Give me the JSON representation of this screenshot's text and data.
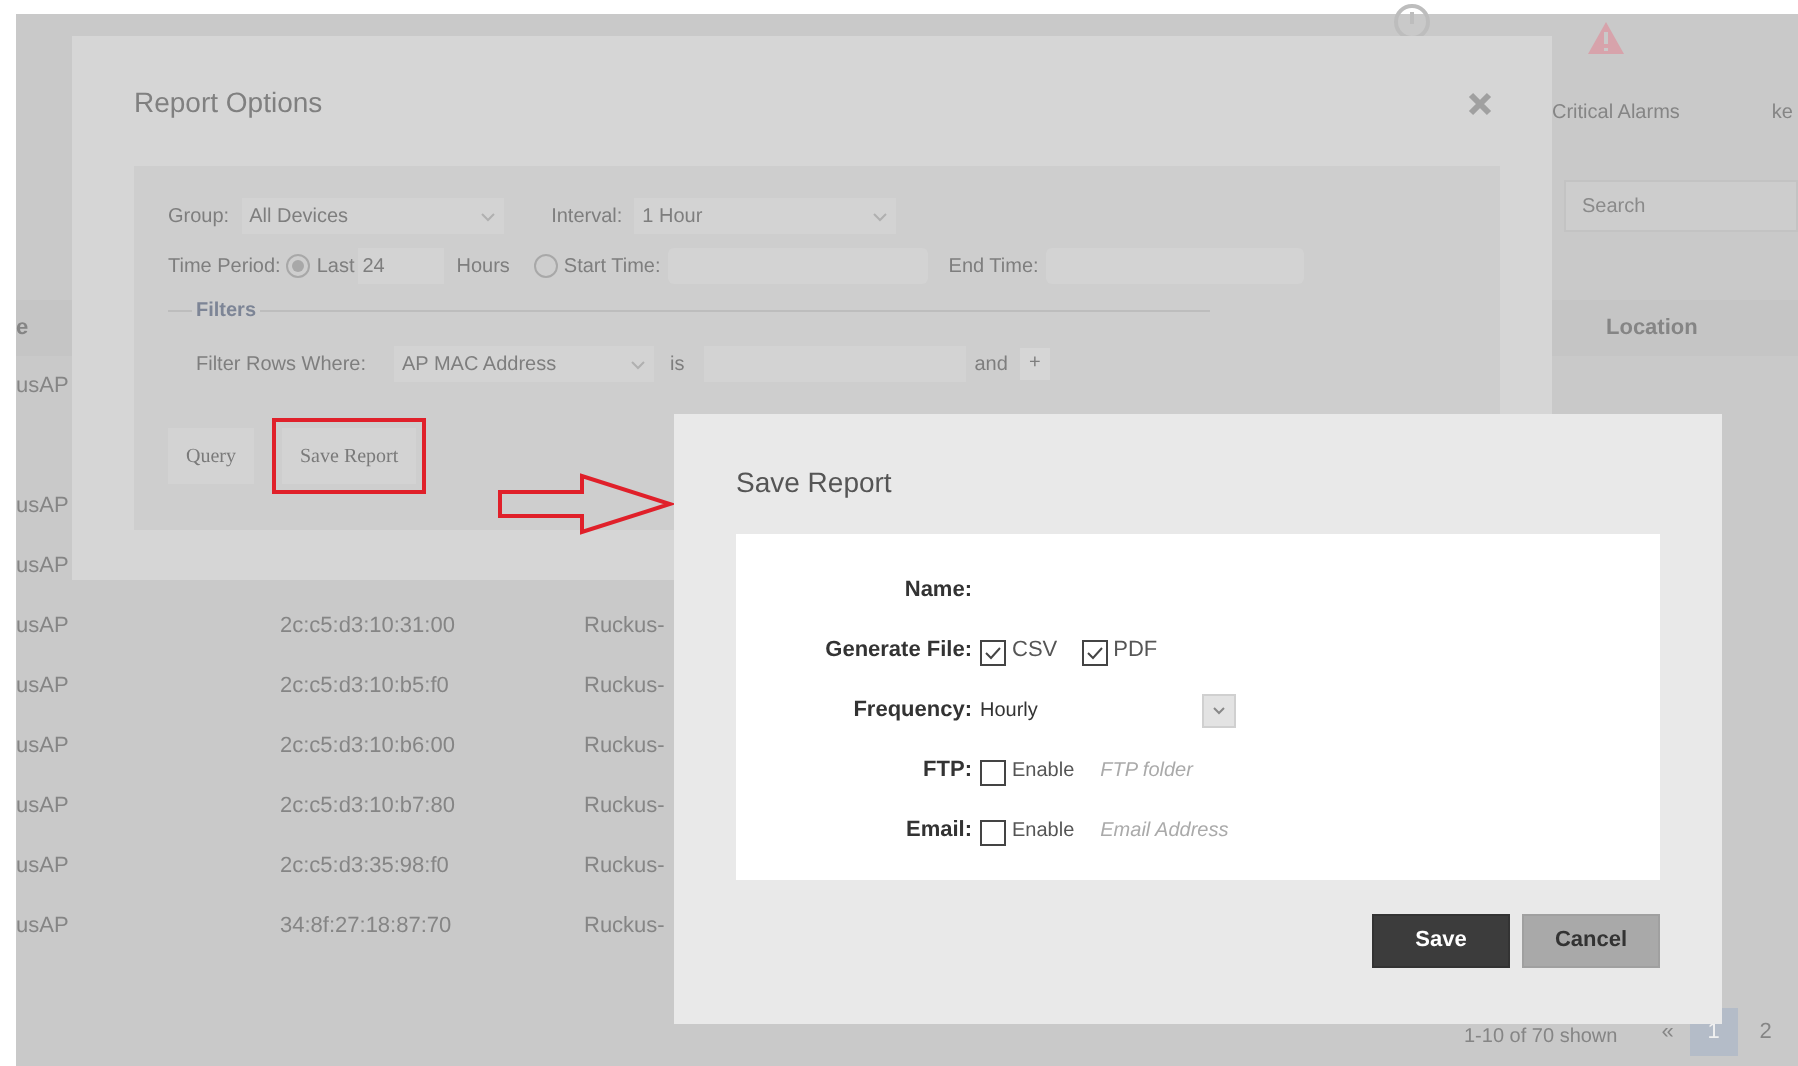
{
  "header": {
    "alarm_label": "Critical Alarms",
    "user": "ke"
  },
  "search": {
    "placeholder": "Search"
  },
  "table": {
    "columns": [
      "e",
      "Location"
    ],
    "rows": [
      {
        "column_1": "usAP"
      },
      {
        "column_1": "usAP"
      },
      {
        "column_1": "usAP"
      },
      {
        "column_1": "usAP",
        "column_2": "2c:c5:d3:10:31:00",
        "column_3": "Ruckus-"
      },
      {
        "column_1": "usAP",
        "column_2": "2c:c5:d3:10:b5:f0",
        "column_3": "Ruckus-"
      },
      {
        "column_1": "usAP",
        "column_2": "2c:c5:d3:10:b6:00",
        "column_3": "Ruckus-"
      },
      {
        "column_1": "usAP",
        "column_2": "2c:c5:d3:10:b7:80",
        "column_3": "Ruckus-"
      },
      {
        "column_1": "usAP",
        "column_2": "2c:c5:d3:35:98:f0",
        "column_3": "Ruckus-"
      },
      {
        "column_1": "usAP",
        "column_2": "34:8f:27:18:87:70",
        "column_3": "Ruckus-"
      }
    ]
  },
  "pagination": {
    "summary": "1-10 of 70 shown",
    "prev": "«",
    "pages": [
      {
        "label": "1",
        "selected": true
      },
      {
        "label": "2",
        "selected": false
      }
    ]
  },
  "report_options": {
    "title": "Report Options",
    "group": {
      "label": "Group:",
      "value": "All Devices"
    },
    "interval": {
      "label": "Interval:",
      "value": "1 Hour"
    },
    "time_period": {
      "label": "Time Period:",
      "options": [
        {
          "label": "Last",
          "selected": true,
          "value": "24",
          "unit": "Hours"
        },
        {
          "label": "Start Time:",
          "selected": false
        }
      ],
      "end_label": "End Time:"
    },
    "filters": {
      "legend": "Filters",
      "label": "Filter Rows Where:",
      "field": "AP MAC Address",
      "operator": "is",
      "conjunction": "and",
      "add": "+"
    },
    "buttons": [
      {
        "label": "Query",
        "highlighted": false
      },
      {
        "label": "Save Report",
        "highlighted": true
      }
    ]
  },
  "save_report": {
    "title": "Save Report",
    "rows": [
      {
        "kind": "name",
        "label": "Name:"
      },
      {
        "kind": "files",
        "label": "Generate File:",
        "options": [
          {
            "label": "CSV",
            "checked": true
          },
          {
            "label": "PDF",
            "checked": true
          }
        ]
      },
      {
        "kind": "select",
        "label": "Frequency:",
        "value": "Hourly"
      },
      {
        "kind": "toggle",
        "label": "FTP:",
        "option": {
          "label": "Enable",
          "checked": false
        },
        "placeholder": "FTP folder"
      },
      {
        "kind": "toggle",
        "label": "Email:",
        "option": {
          "label": "Enable",
          "checked": false
        },
        "placeholder": "Email Address"
      }
    ],
    "buttons": [
      {
        "label": "Save",
        "kind": "primary"
      },
      {
        "label": "Cancel",
        "kind": "secondary"
      }
    ]
  }
}
